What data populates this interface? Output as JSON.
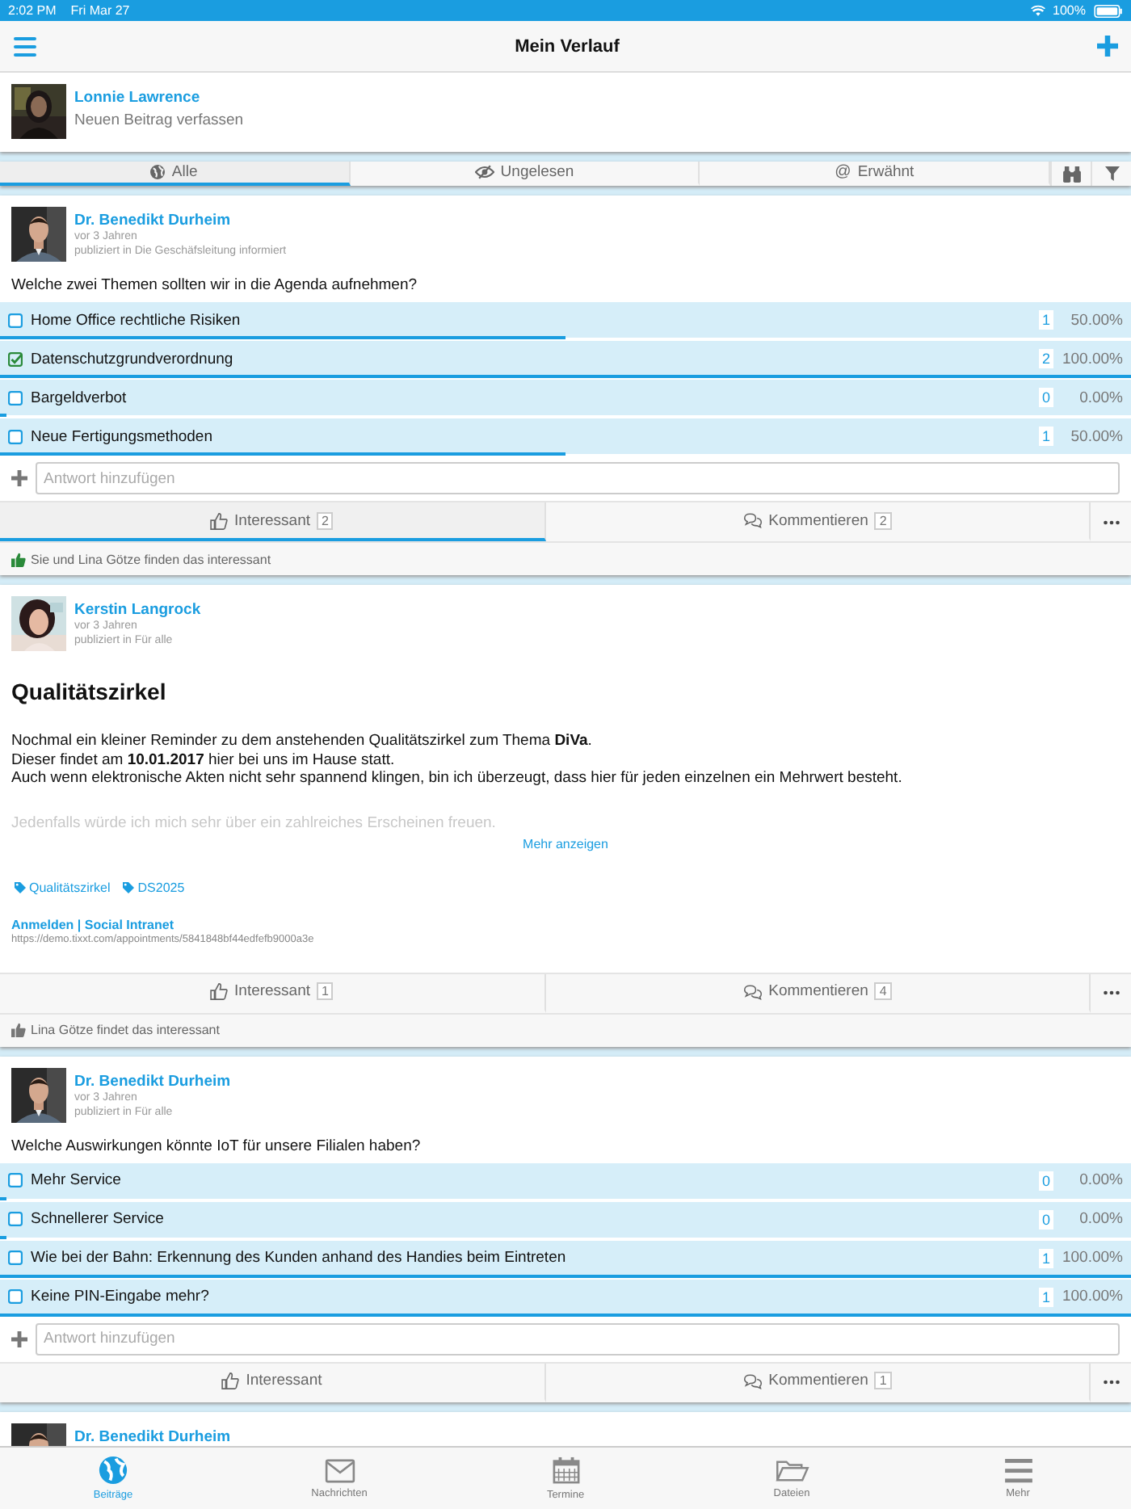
{
  "status_bar": {
    "time": "2:02 PM",
    "date": "Fri Mar 27",
    "battery": "100%"
  },
  "nav": {
    "title": "Mein Verlauf"
  },
  "composer": {
    "name": "Lonnie Lawrence",
    "prompt": "Neuen Beitrag verfassen"
  },
  "filter_tabs": [
    {
      "label": "Alle",
      "selected": true
    },
    {
      "label": "Ungelesen",
      "selected": false
    },
    {
      "symbol": "@",
      "label": "Erwähnt",
      "selected": false
    }
  ],
  "posts": [
    {
      "kind": "poll",
      "author": "Dr. Benedikt Durheim",
      "time": "vor 3 Jahren",
      "published_in": "publiziert in Die Geschäfsleitung informiert",
      "question": "Welche zwei Themen sollten wir in die Agenda aufnehmen?",
      "options": [
        {
          "label": "Home Office rechtliche Risiken",
          "checked": false,
          "count": "1",
          "percent": "50.00%",
          "level": 0.5
        },
        {
          "label": "Datenschutzgrundverordnung",
          "checked": true,
          "count": "2",
          "percent": "100.00%",
          "level": 1
        },
        {
          "label": "Bargeldverbot",
          "checked": false,
          "count": "0",
          "percent": "0.00%",
          "level": 0
        },
        {
          "label": "Neue Fertigungsmethoden",
          "checked": false,
          "count": "1",
          "percent": "50.00%",
          "level": 0.5
        }
      ],
      "answer_placeholder": "Antwort hinzufügen",
      "like_label": "Interessant",
      "like_count": "2",
      "liked": true,
      "comment_label": "Kommentieren",
      "comment_count": "2",
      "likes_note": "Sie und Lina Götze finden das interessant"
    },
    {
      "kind": "article",
      "author": "Kerstin Langrock",
      "time": "vor 3 Jahren",
      "published_in": "publiziert in Für alle",
      "title": "Qualitätszirkel",
      "body": [
        "Nochmal ein kleiner Reminder zu dem anstehenden Qualitätszirkel zum Thema **DiVa**.",
        "Dieser findet am **10.01.2017** hier bei uns im Hause statt.",
        "Auch wenn elektronische Akten nicht sehr spannend klingen, bin ich überzeugt, dass hier für jeden einzelnen ein Mehrwert besteht."
      ],
      "faded_line": "Jedenfalls würde ich mich sehr über ein zahlreiches Erscheinen freuen.",
      "more": "Mehr anzeigen",
      "tags": [
        "Qualitätszirkel",
        "DS2025"
      ],
      "link_title": "Anmelden | Social Intranet",
      "link_url": "https://demo.tixxt.com/appointments/5841848bf44edfefb9000a3e",
      "like_label": "Interessant",
      "like_count": "1",
      "liked": false,
      "comment_label": "Kommentieren",
      "comment_count": "4",
      "likes_note": "Lina Götze findet das interessant"
    },
    {
      "kind": "poll",
      "author": "Dr. Benedikt Durheim",
      "time": "vor 3 Jahren",
      "published_in": "publiziert in Für alle",
      "question": "Welche Auswirkungen könnte IoT für unsere Filialen haben?",
      "options": [
        {
          "label": "Mehr Service",
          "checked": false,
          "count": "0",
          "percent": "0.00%",
          "level": 0
        },
        {
          "label": "Schnellerer Service",
          "checked": false,
          "count": "0",
          "percent": "0.00%",
          "level": 0
        },
        {
          "label": "Wie bei der Bahn: Erkennung des Kunden anhand des Handies beim Eintreten",
          "checked": false,
          "count": "1",
          "percent": "100.00%",
          "level": 1
        },
        {
          "label": "Keine PIN-Eingabe mehr?",
          "checked": false,
          "count": "1",
          "percent": "100.00%",
          "level": 1
        }
      ],
      "answer_placeholder": "Antwort hinzufügen",
      "like_label": "Interessant",
      "liked": false,
      "comment_label": "Kommentieren",
      "comment_count": "1"
    },
    {
      "kind": "stub",
      "author": "Dr. Benedikt Durheim"
    }
  ],
  "bottom_tabs": [
    {
      "label": "Beiträge",
      "selected": true
    },
    {
      "label": "Nachrichten",
      "selected": false
    },
    {
      "label": "Termine",
      "selected": false
    },
    {
      "label": "Dateien",
      "selected": false
    },
    {
      "label": "Mehr",
      "selected": false
    }
  ]
}
